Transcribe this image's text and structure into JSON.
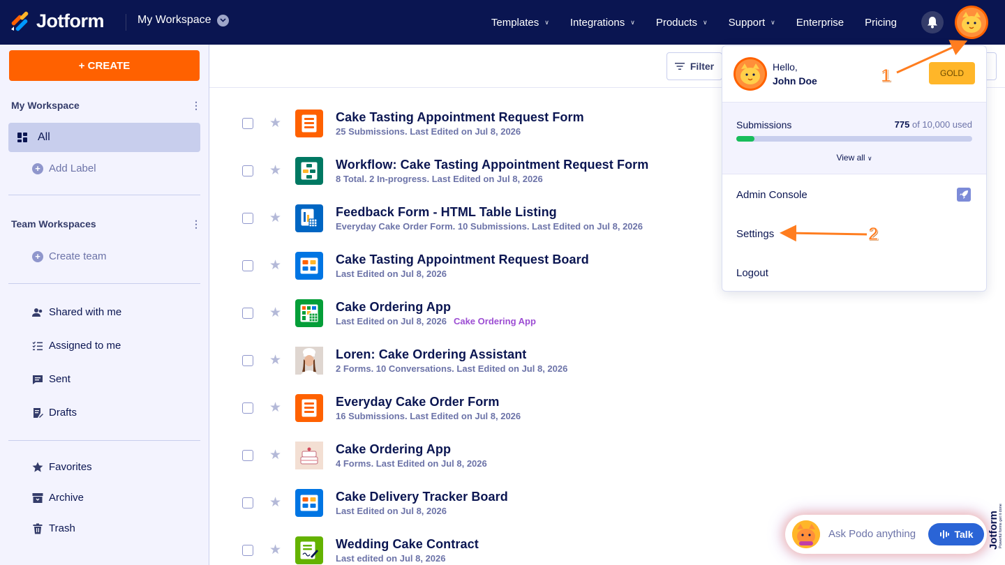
{
  "app": {
    "brand": "Jotform",
    "brand_color": "#0a1551",
    "accent": "#ff6100"
  },
  "header": {
    "workspace": "My Workspace",
    "nav": [
      {
        "label": "Templates",
        "has_menu": true
      },
      {
        "label": "Integrations",
        "has_menu": true
      },
      {
        "label": "Products",
        "has_menu": true
      },
      {
        "label": "Support",
        "has_menu": true
      },
      {
        "label": "Enterprise",
        "has_menu": false
      },
      {
        "label": "Pricing",
        "has_menu": false
      }
    ]
  },
  "sidebar": {
    "create_label": "+ CREATE",
    "my_workspace": "My Workspace",
    "all_label": "All",
    "add_label": "Add Label",
    "team_workspaces": "Team Workspaces",
    "create_team": "Create team",
    "items": [
      {
        "label": "Shared with me",
        "icon": "people-icon"
      },
      {
        "label": "Assigned to me",
        "icon": "checklist-icon"
      },
      {
        "label": "Sent",
        "icon": "message-icon"
      },
      {
        "label": "Drafts",
        "icon": "draft-icon"
      },
      {
        "label": "Favorites",
        "icon": "star-icon"
      },
      {
        "label": "Archive",
        "icon": "archive-icon"
      },
      {
        "label": "Trash",
        "icon": "trash-icon"
      }
    ]
  },
  "toolbar": {
    "filter_label": "Filter"
  },
  "forms": [
    {
      "title": "Cake Tasting Appointment Request Form",
      "meta": "25 Submissions. Last Edited on Jul 8, 2026",
      "tag": "",
      "icon": "form-icon",
      "color": "#ff6100"
    },
    {
      "title": "Workflow: Cake Tasting Appointment Request Form",
      "meta": "8 Total. 2 In-progress. Last Edited on Jul 8, 2026",
      "tag": "",
      "icon": "workflow-icon",
      "color": "#007862"
    },
    {
      "title": "Feedback Form - HTML Table Listing",
      "meta": "Everyday Cake Order Form. 10 Submissions. Last Edited on Jul 8, 2026",
      "tag": "",
      "icon": "report-icon",
      "color": "#0066c3"
    },
    {
      "title": "Cake Tasting Appointment Request Board",
      "meta": "Last Edited on Jul 8, 2026",
      "tag": "",
      "icon": "board-icon",
      "color": "#0075e3"
    },
    {
      "title": "Cake Ordering App",
      "meta": "Last Edited on Jul 8, 2026",
      "tag": "Cake Ordering App",
      "icon": "table-icon",
      "color": "#049e38"
    },
    {
      "title": "Loren: Cake Ordering Assistant",
      "meta": "2 Forms. 10 Conversations. Last Edited on Jul 8, 2026",
      "tag": "",
      "icon": "agent-avatar-icon",
      "color": "#e8e0dc"
    },
    {
      "title": "Everyday Cake Order Form",
      "meta": "16 Submissions. Last Edited on Jul 8, 2026",
      "tag": "",
      "icon": "form-icon",
      "color": "#ff6100"
    },
    {
      "title": "Cake Ordering App",
      "meta": "4 Forms. Last Edited on Jul 8, 2026",
      "tag": "",
      "icon": "cake-app-icon",
      "color": "#f3dfd3"
    },
    {
      "title": "Cake Delivery Tracker Board",
      "meta": "Last Edited on Jul 8, 2026",
      "tag": "",
      "icon": "board-icon",
      "color": "#0075e3"
    },
    {
      "title": "Wedding Cake Contract",
      "meta": "Last edited on Jul 8, 2026",
      "tag": "",
      "icon": "sign-icon",
      "color": "#64b200"
    }
  ],
  "account_menu": {
    "hello": "Hello,",
    "name": "John Doe",
    "plan": "GOLD",
    "submissions_label": "Submissions",
    "used": "775",
    "limit_text": " of 10,000 used",
    "usage_fraction": 0.0775,
    "view_all": "View all",
    "admin_console": "Admin Console",
    "settings": "Settings",
    "logout": "Logout"
  },
  "annotations": {
    "step1": "1",
    "step2": "2",
    "arrow_color": "#ff7d1f"
  },
  "podo": {
    "placeholder": "Ask Podo anything",
    "talk_label": "Talk"
  },
  "side_brand": {
    "name": "Jotform",
    "tagline": "Powerful forms get it done"
  }
}
